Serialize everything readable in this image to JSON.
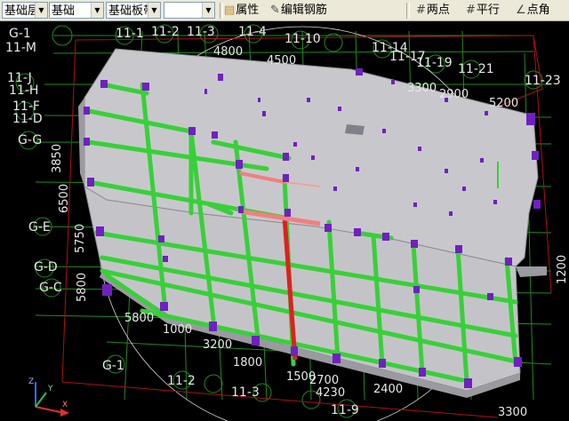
{
  "toolbar": {
    "combo1": "基础层",
    "combo2": "基础",
    "combo3": "基础板带",
    "combo4": "",
    "btn_property": "属性",
    "btn_edit_rebar": "编辑钢筋",
    "btn_two_points": "两点",
    "btn_parallel": "平行",
    "btn_point_angle": "点角"
  },
  "grid_labels": [
    {
      "id": "g-m-left",
      "text": "G-1"
    },
    {
      "id": "l-11m",
      "text": "11-M"
    },
    {
      "id": "l-11j",
      "text": "11-J"
    },
    {
      "id": "l-11h",
      "text": "11-H"
    },
    {
      "id": "l-11f",
      "text": "11-F"
    },
    {
      "id": "l-11d",
      "text": "11-D"
    },
    {
      "id": "l-gg",
      "text": "G-G"
    },
    {
      "id": "l-ge",
      "text": "G-E"
    },
    {
      "id": "l-gd",
      "text": "G-D"
    },
    {
      "id": "l-gc",
      "text": "G-C"
    },
    {
      "id": "t-111",
      "text": "11-1"
    },
    {
      "id": "t-112",
      "text": "11-2"
    },
    {
      "id": "t-113",
      "text": "11-3"
    },
    {
      "id": "t-114",
      "text": "11-4"
    },
    {
      "id": "t-1110",
      "text": "11-10"
    },
    {
      "id": "t-1114",
      "text": "11-14"
    },
    {
      "id": "t-1117",
      "text": "11-17"
    },
    {
      "id": "t-1119",
      "text": "11-19"
    },
    {
      "id": "t-1121",
      "text": "11-21"
    },
    {
      "id": "t-1123",
      "text": "11-23"
    },
    {
      "id": "b-g1",
      "text": "G-1"
    },
    {
      "id": "b-112",
      "text": "11-2"
    },
    {
      "id": "b-113",
      "text": "11-3"
    },
    {
      "id": "b-119",
      "text": "11-9"
    }
  ],
  "dimensions": [
    {
      "id": "d-4800",
      "text": "4800"
    },
    {
      "id": "d-4500",
      "text": "4500"
    },
    {
      "id": "d-3300",
      "text": "3300"
    },
    {
      "id": "d-2900",
      "text": "2900"
    },
    {
      "id": "d-5200",
      "text": "5200"
    },
    {
      "id": "d-3850",
      "text": "3850"
    },
    {
      "id": "d-6500",
      "text": "6500"
    },
    {
      "id": "d-5750",
      "text": "5750"
    },
    {
      "id": "d-5800l",
      "text": "5800"
    },
    {
      "id": "d-5800b",
      "text": "5800"
    },
    {
      "id": "d-1000",
      "text": "1000"
    },
    {
      "id": "d-3200",
      "text": "3200"
    },
    {
      "id": "d-1800",
      "text": "1800"
    },
    {
      "id": "d-1500",
      "text": "1500"
    },
    {
      "id": "d-2700",
      "text": "2700"
    },
    {
      "id": "d-4230",
      "text": "4230"
    },
    {
      "id": "d-2400",
      "text": "2400"
    },
    {
      "id": "d-3300b",
      "text": "3300"
    },
    {
      "id": "d-1200",
      "text": "1200"
    }
  ],
  "colors": {
    "background": "#000000",
    "slab_top": "#c8c8cc",
    "slab_side": "#9a9aa0",
    "beam_green": "#38d038",
    "beam_red": "#e02020",
    "column_purple": "#7020c0",
    "grid_green": "#1e8c1e",
    "axis_red": "#b01010",
    "toolbar_bg": "#ece9d8"
  },
  "axis_icon": {
    "x": "X",
    "y": "Y",
    "z": "Z"
  }
}
